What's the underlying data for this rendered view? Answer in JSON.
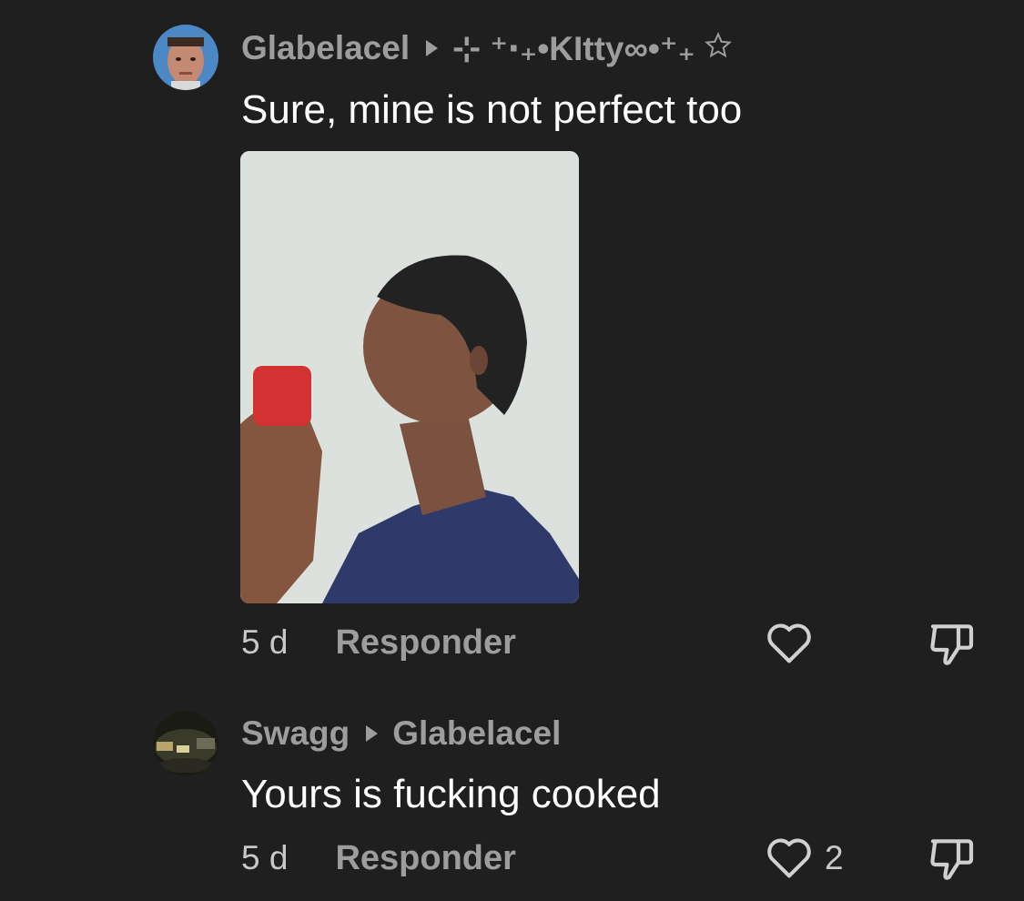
{
  "comments": [
    {
      "author": "Glabelacel",
      "reply_to": "⊹ ⁺‧₊•KItty∞•⁺₊",
      "reply_to_icon": "star-outline-icon",
      "text": "Sure, mine is not perfect too",
      "time": "5 d",
      "reply_label": "Responder",
      "likes": ""
    },
    {
      "author": "Swagg",
      "reply_to": "Glabelacel",
      "text": "Yours is fucking cooked",
      "time": "5 d",
      "reply_label": "Responder",
      "likes": "2"
    }
  ],
  "colors": {
    "background": "#1f1f1f",
    "muted_text": "#9d9d9d",
    "primary_text": "#ffffff"
  }
}
